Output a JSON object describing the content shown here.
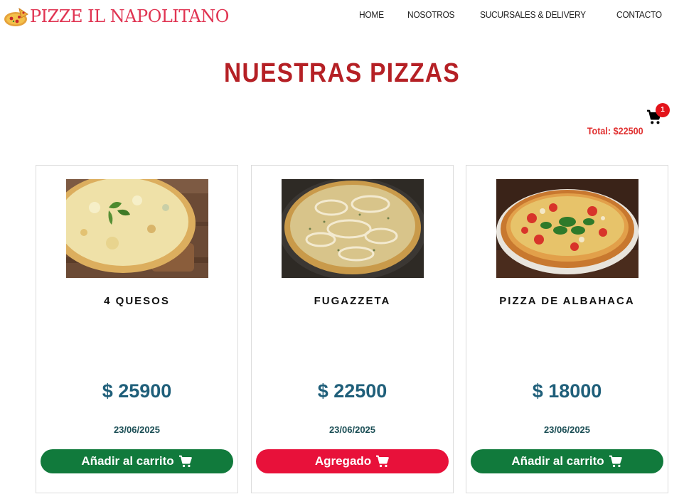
{
  "brand": {
    "name": "PIZZE IL NAPOLITANO",
    "logo_icon": "pizza-slice-icon"
  },
  "nav": {
    "items": [
      {
        "label": "HOME"
      },
      {
        "label": "NOSOTROS"
      },
      {
        "label": "SUCURSALES & DELIVERY"
      },
      {
        "label": "CONTACTO"
      }
    ]
  },
  "page": {
    "title": "NUESTRAS PIZZAS"
  },
  "cart": {
    "icon": "cart-icon",
    "count": "1",
    "total": "Total: $22500",
    "badge_color": "#e3131a"
  },
  "products": [
    {
      "name": "4 QUESOS",
      "price": "$ 25900",
      "date": "23/06/2025",
      "button": "Añadir al carrito",
      "state": "default"
    },
    {
      "name": "FUGAZZETA",
      "price": "$ 22500",
      "date": "23/06/2025",
      "button": "Agregado",
      "state": "added"
    },
    {
      "name": "PIZZA DE ALBAHACA",
      "price": "$ 18000",
      "date": "23/06/2025",
      "button": "Añadir al carrito",
      "state": "default"
    }
  ],
  "colors": {
    "brand": "#e03452",
    "title": "#b52025",
    "price": "#1f5f7a",
    "add_button": "#117a3c",
    "added_button": "#e8113a"
  }
}
